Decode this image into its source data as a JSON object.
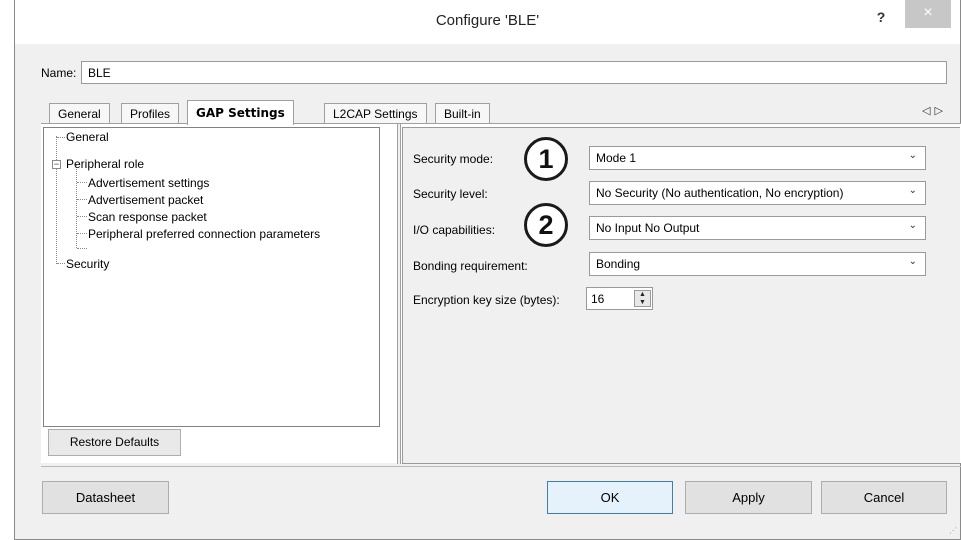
{
  "window": {
    "title": "Configure 'BLE'",
    "help_label": "?",
    "close_label": "×"
  },
  "name": {
    "label": "Name:",
    "value": "BLE"
  },
  "tabs": {
    "items": [
      "General",
      "Profiles",
      "GAP Settings",
      "L2CAP Settings",
      "Built-in"
    ],
    "active": "GAP Settings",
    "scroll_arrows": "◁▷"
  },
  "tree": {
    "items": [
      "General",
      "Peripheral role",
      "Advertisement settings",
      "Advertisement packet",
      "Scan response packet",
      "Peripheral preferred connection parameters",
      "Security"
    ],
    "expander": "−",
    "restore_label": "Restore Defaults"
  },
  "settings": {
    "security_mode": {
      "label": "Security mode:",
      "value": "Mode 1"
    },
    "security_level": {
      "label": "Security level:",
      "value": "No Security (No authentication, No encryption)"
    },
    "io_capabilities": {
      "label": "I/O capabilities:",
      "value": "No Input No Output"
    },
    "bonding": {
      "label": "Bonding requirement:",
      "value": "Bonding"
    },
    "key_size": {
      "label": "Encryption key size (bytes):",
      "value": "16"
    },
    "badges": [
      "1",
      "2"
    ],
    "chevron": "⌄"
  },
  "buttons": {
    "datasheet": "Datasheet",
    "ok": "OK",
    "apply": "Apply",
    "cancel": "Cancel"
  }
}
